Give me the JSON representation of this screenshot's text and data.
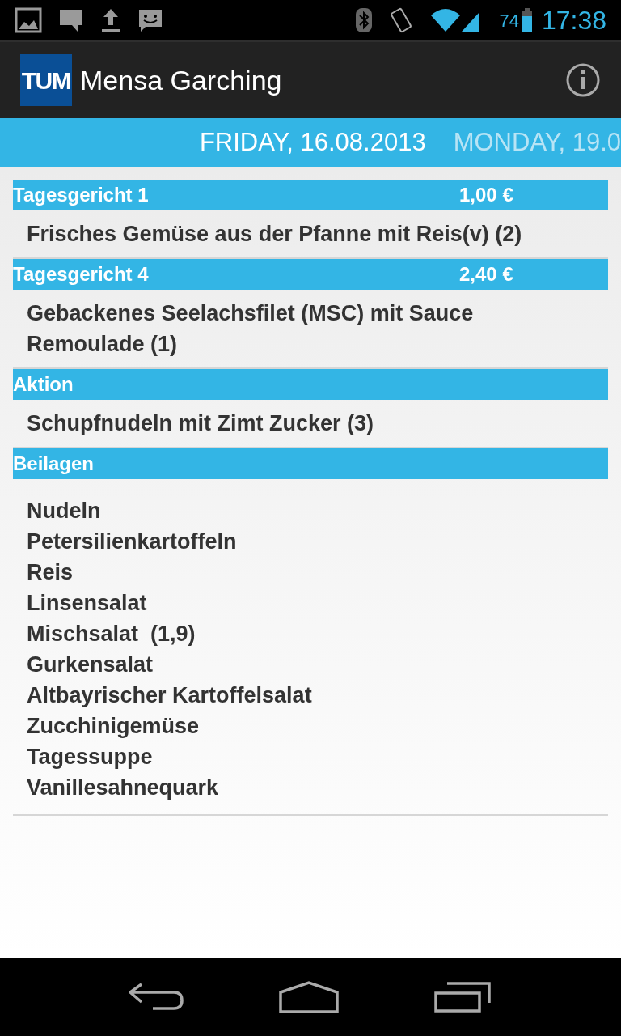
{
  "status_bar": {
    "battery": "74",
    "time": "17:38"
  },
  "action_bar": {
    "logo_text": "TUM",
    "title": "Mensa Garching"
  },
  "day_tabs": [
    {
      "label": "FRIDAY, 16.08.2013",
      "selected": true
    },
    {
      "label": "MONDAY, 19.0",
      "selected": false
    }
  ],
  "sections": [
    {
      "title": "Tagesgericht 1",
      "price": "1,00 €",
      "items": [
        "Frisches Gemüse aus der Pfanne mit Reis(v) (2)"
      ]
    },
    {
      "title": "Tagesgericht 4",
      "price": "2,40 €",
      "items": [
        "Gebackenes Seelachsfilet (MSC) mit Sauce Remoulade (1)"
      ]
    },
    {
      "title": "Aktion",
      "items": [
        "Schupfnudeln mit Zimt Zucker (3)"
      ]
    },
    {
      "title": "Beilagen",
      "items": [
        "Nudeln",
        "Petersilienkartoffeln",
        "Reis",
        "Linsensalat",
        "Mischsalat  (1,9)",
        "Gurkensalat",
        "Altbayrischer Kartoffelsalat",
        "Zucchinigemüse",
        "Tagessuppe",
        "Vanillesahnequark"
      ]
    }
  ]
}
